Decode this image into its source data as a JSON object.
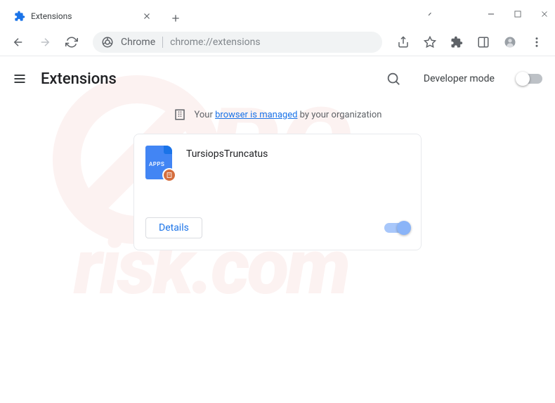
{
  "tab": {
    "title": "Extensions"
  },
  "address": {
    "prefix": "Chrome",
    "url": "chrome://extensions"
  },
  "page": {
    "title": "Extensions",
    "devmode": "Developer mode",
    "managed_prefix": "Your ",
    "managed_link": "browser is managed",
    "managed_suffix": " by your organization"
  },
  "extension": {
    "name": "TursiopsTruncatus",
    "icon_label": "APPS",
    "details": "Details",
    "enabled": true
  }
}
